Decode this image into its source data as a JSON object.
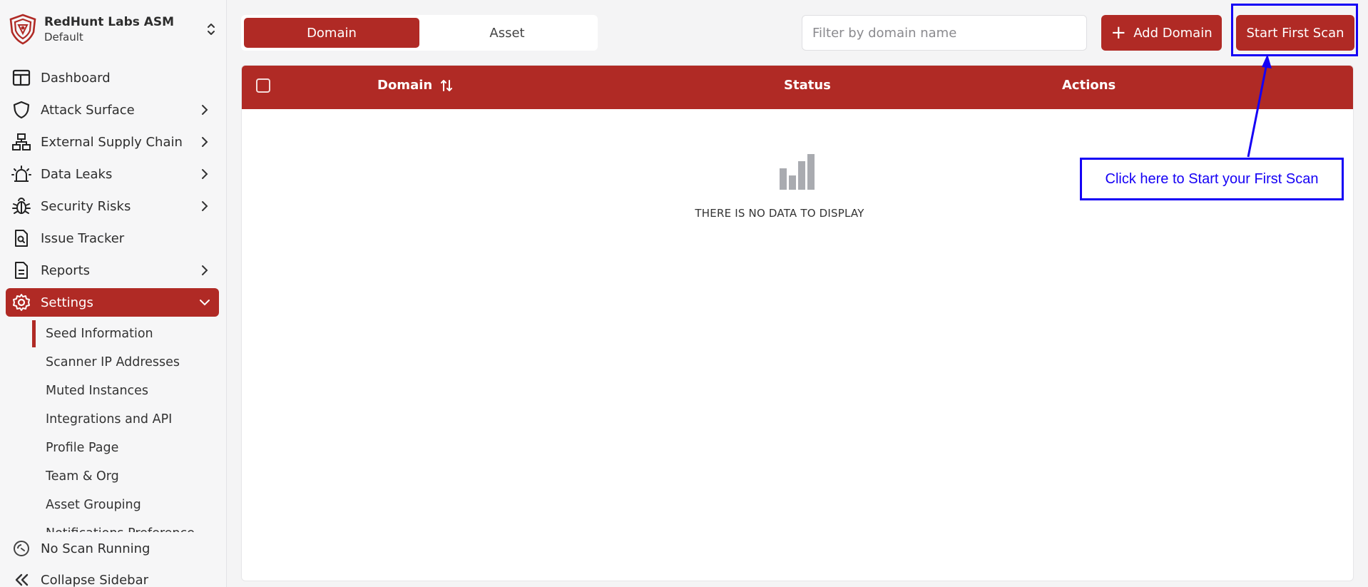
{
  "brand": {
    "title": "RedHunt Labs ASM",
    "subtitle": "Default"
  },
  "nav": [
    {
      "label": "Dashboard",
      "icon": "dashboard-icon",
      "chevron": false
    },
    {
      "label": "Attack Surface",
      "icon": "shield-icon",
      "chevron": true
    },
    {
      "label": "External Supply Chain",
      "icon": "network-icon",
      "chevron": true
    },
    {
      "label": "Data Leaks",
      "icon": "alarm-icon",
      "chevron": true
    },
    {
      "label": "Security Risks",
      "icon": "bug-icon",
      "chevron": true
    },
    {
      "label": "Issue Tracker",
      "icon": "file-search-icon",
      "chevron": false
    },
    {
      "label": "Reports",
      "icon": "document-icon",
      "chevron": true
    },
    {
      "label": "Settings",
      "icon": "gear-icon",
      "chevron": true,
      "active": true
    }
  ],
  "settings_sub": [
    "Seed Information",
    "Scanner IP Addresses",
    "Muted Instances",
    "Integrations and API",
    "Profile Page",
    "Team & Org",
    "Asset Grouping",
    "Notifications Preference"
  ],
  "sidebar_bottom": {
    "scan_status": "No Scan Running",
    "collapse": "Collapse Sidebar"
  },
  "toggle": {
    "domain": "Domain",
    "asset": "Asset"
  },
  "filter": {
    "placeholder": "Filter by domain name",
    "value": ""
  },
  "buttons": {
    "add_domain": "Add Domain",
    "start_scan": "Start First Scan"
  },
  "table": {
    "columns": {
      "domain": "Domain",
      "status": "Status",
      "actions": "Actions"
    },
    "empty_text": "THERE IS NO DATA TO DISPLAY"
  },
  "callout": {
    "text": "Click here to Start your First Scan"
  },
  "colors": {
    "accent": "#b02a25",
    "annotation": "#1500f5"
  }
}
